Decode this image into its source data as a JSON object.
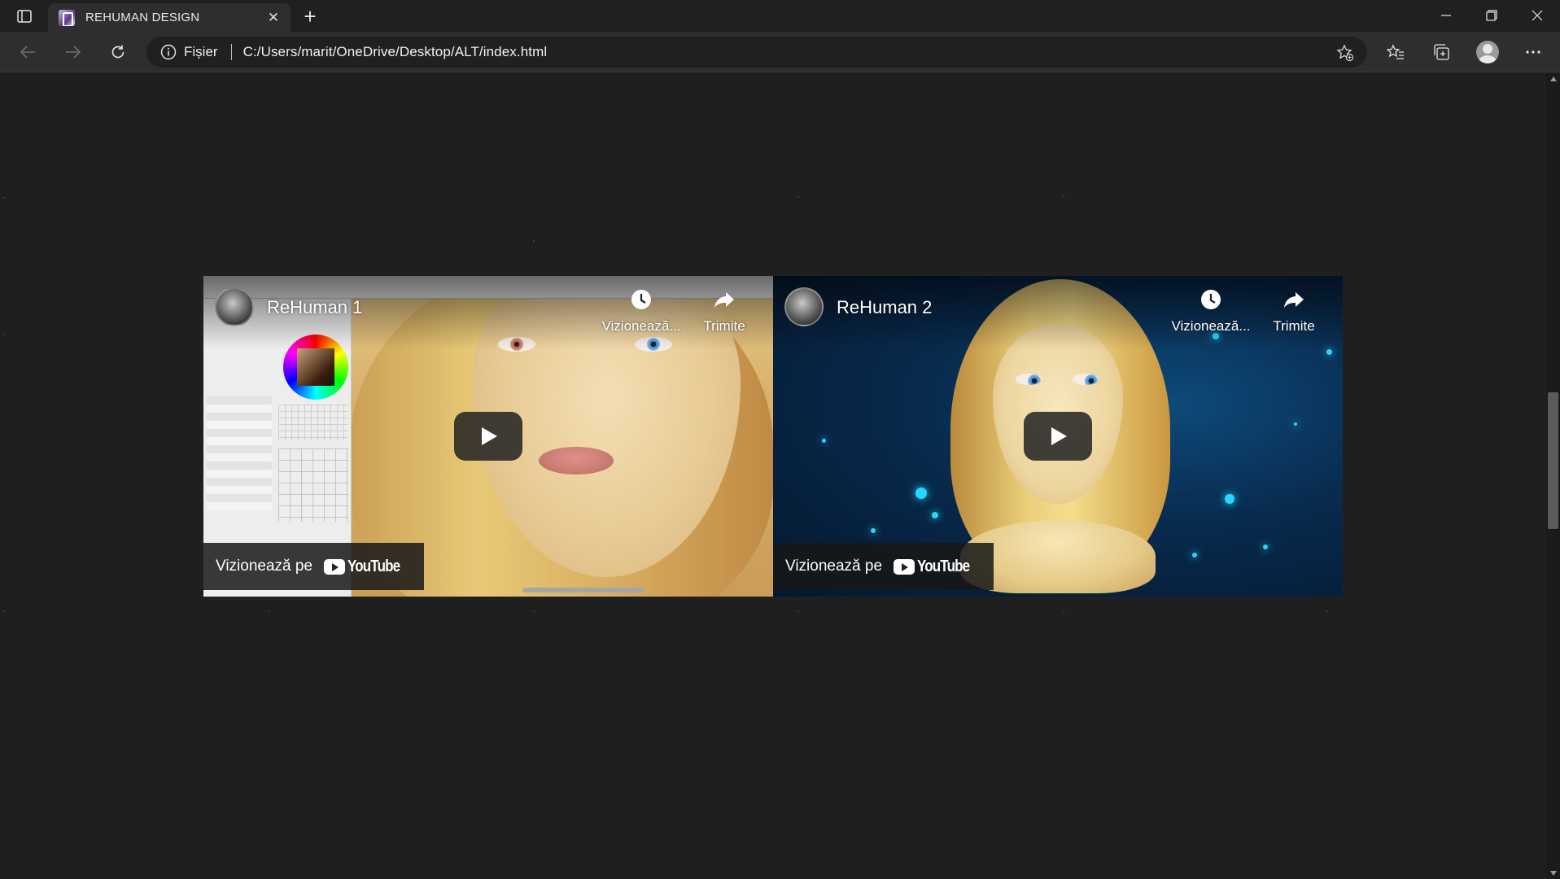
{
  "browser": {
    "tab_title": "REHUMAN DESIGN",
    "close_tab_symbol": "✕",
    "new_tab_symbol": "+",
    "address": {
      "origin_label": "Fișier",
      "url": "C:/Users/marit/OneDrive/Desktop/ALT/index.html"
    }
  },
  "videos": [
    {
      "title": "ReHuman 1",
      "watch_later_label": "Vizionează...",
      "share_label": "Trimite",
      "watch_on_label": "Vizionează pe",
      "platform_label": "YouTube"
    },
    {
      "title": "ReHuman 2",
      "watch_later_label": "Vizionează...",
      "share_label": "Trimite",
      "watch_on_label": "Vizionează pe",
      "platform_label": "YouTube"
    }
  ],
  "colors": {
    "page_background": "#1f1f1f",
    "chrome_background": "#202020",
    "toolbar_background": "#2e2e2e",
    "bokeh_accent": "#27d6ff"
  }
}
